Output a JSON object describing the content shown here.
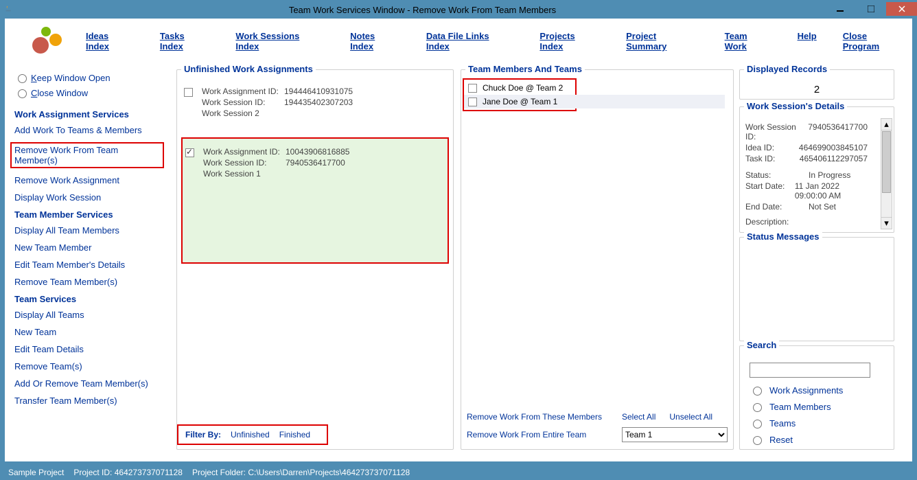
{
  "window": {
    "title": "Team Work Services Window - Remove Work From Team Members"
  },
  "menus": {
    "ideas": "Ideas Index",
    "tasks": "Tasks Index",
    "work_sessions": "Work Sessions Index",
    "notes": "Notes Index",
    "data_file": "Data File Links Index",
    "projects": "Projects Index",
    "project_summary": "Project Summary",
    "team_work": "Team Work",
    "help": "Help",
    "close": "Close Program"
  },
  "sidebar": {
    "keep_open": "Keep Window Open",
    "close_window": "Close Window",
    "sections": {
      "work_assignment": {
        "title": "Work Assignment Services",
        "links": [
          "Add Work To Teams & Members",
          "Remove Work From Team Member(s)",
          "Remove Work Assignment",
          "Display Work Session"
        ]
      },
      "team_member": {
        "title": "Team Member Services",
        "links": [
          "Display All Team Members",
          "New Team Member",
          "Edit Team Member's Details",
          "Remove Team Member(s)"
        ]
      },
      "team": {
        "title": "Team Services",
        "links": [
          "Display All Teams",
          "New Team",
          "Edit Team Details",
          "Remove Team(s)",
          "Add Or Remove Team Member(s)",
          "Transfer Team Member(s)"
        ]
      }
    }
  },
  "unfinished": {
    "title": "Unfinished Work Assignments",
    "items": [
      {
        "checked": false,
        "wa_label": "Work Assignment ID:",
        "wa_id": "194446410931075",
        "ws_label": "Work Session ID:",
        "ws_id": "194435402307203",
        "name": "Work Session 2"
      },
      {
        "checked": true,
        "wa_label": "Work Assignment ID:",
        "wa_id": "10043906816885",
        "ws_label": "Work Session ID:",
        "ws_id": "7940536417700",
        "name": "Work Session 1"
      }
    ],
    "filter_label": "Filter By:",
    "filter_unfinished": "Unfinished",
    "filter_finished": "Finished"
  },
  "team_members": {
    "title": "Team Members And Teams",
    "members": [
      {
        "checked": false,
        "name": "Chuck Doe @ Team 2"
      },
      {
        "checked": false,
        "name": "Jane Doe @ Team 1",
        "highlight": true
      }
    ],
    "remove_members_label": "Remove Work From These Members",
    "select_all": "Select All",
    "unselect_all": "Unselect All",
    "remove_team_label": "Remove Work From Entire Team",
    "team_selected": "Team 1"
  },
  "displayed": {
    "title": "Displayed Records",
    "value": "2"
  },
  "ws_details": {
    "title": "Work Session's Details",
    "rows": {
      "ws_k": "Work Session ID:",
      "ws_v": "7940536417700",
      "idea_k": "Idea ID:",
      "idea_v": "464699003845107",
      "task_k": "Task ID:",
      "task_v": "465406112297057",
      "status_k": "Status:",
      "status_v": "In Progress",
      "start_k": "Start Date:",
      "start_v": "11 Jan 2022  09:00:00 AM",
      "end_k": "End Date:",
      "end_v": "Not Set",
      "desc_k": "Description:"
    }
  },
  "status_messages": {
    "title": "Status Messages"
  },
  "search": {
    "title": "Search",
    "options": [
      "Work Assignments",
      "Team Members",
      "Teams",
      "Reset"
    ]
  },
  "statusbar": {
    "project": "Sample Project",
    "pid_label": "Project ID: 464273737071128",
    "folder_label": "Project Folder: C:\\Users\\Darren\\Projects\\464273737071128"
  }
}
